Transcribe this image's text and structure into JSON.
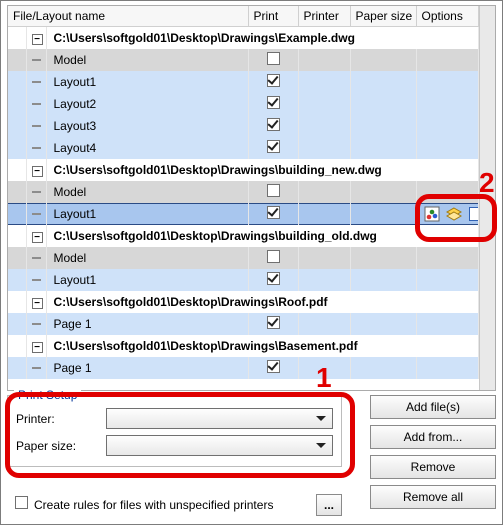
{
  "columns": {
    "name": "File/Layout name",
    "print": "Print",
    "printer": "Printer",
    "paper": "Paper size",
    "options": "Options"
  },
  "files": [
    {
      "path": "C:\\Users\\softgold01\\Desktop\\Drawings\\Example.dwg",
      "children": [
        {
          "name": "Model",
          "kind": "model",
          "checked": false
        },
        {
          "name": "Layout1",
          "kind": "layout",
          "checked": true
        },
        {
          "name": "Layout2",
          "kind": "layout",
          "checked": true
        },
        {
          "name": "Layout3",
          "kind": "layout",
          "checked": true
        },
        {
          "name": "Layout4",
          "kind": "layout",
          "checked": true
        }
      ]
    },
    {
      "path": "C:\\Users\\softgold01\\Desktop\\Drawings\\building_new.dwg",
      "children": [
        {
          "name": "Model",
          "kind": "model",
          "checked": false
        },
        {
          "name": "Layout1",
          "kind": "layout",
          "checked": true,
          "selected": true,
          "show_opts": true
        }
      ]
    },
    {
      "path": "C:\\Users\\softgold01\\Desktop\\Drawings\\building_old.dwg",
      "children": [
        {
          "name": "Model",
          "kind": "model",
          "checked": false
        },
        {
          "name": "Layout1",
          "kind": "layout",
          "checked": true
        }
      ]
    },
    {
      "path": "C:\\Users\\softgold01\\Desktop\\Drawings\\Roof.pdf",
      "children": [
        {
          "name": "Page 1",
          "kind": "layout",
          "checked": true
        }
      ]
    },
    {
      "path": "C:\\Users\\softgold01\\Desktop\\Drawings\\Basement.pdf",
      "children": [
        {
          "name": "Page 1",
          "kind": "layout",
          "checked": true
        }
      ]
    }
  ],
  "print_setup": {
    "title": "Print Setup",
    "printer_label": "Printer:",
    "paper_label": "Paper size:",
    "printer_value": "",
    "paper_value": ""
  },
  "rules": {
    "label": "Create rules for files with unspecified printers",
    "checked": false,
    "button": "..."
  },
  "buttons": {
    "add_files": "Add file(s)",
    "add_from": "Add from...",
    "remove": "Remove",
    "remove_all": "Remove all"
  },
  "annotations": {
    "one": "1",
    "two": "2"
  },
  "icons": {
    "plot_style": "plot-style-icon",
    "layers": "layers-icon",
    "view": "view-icon"
  }
}
